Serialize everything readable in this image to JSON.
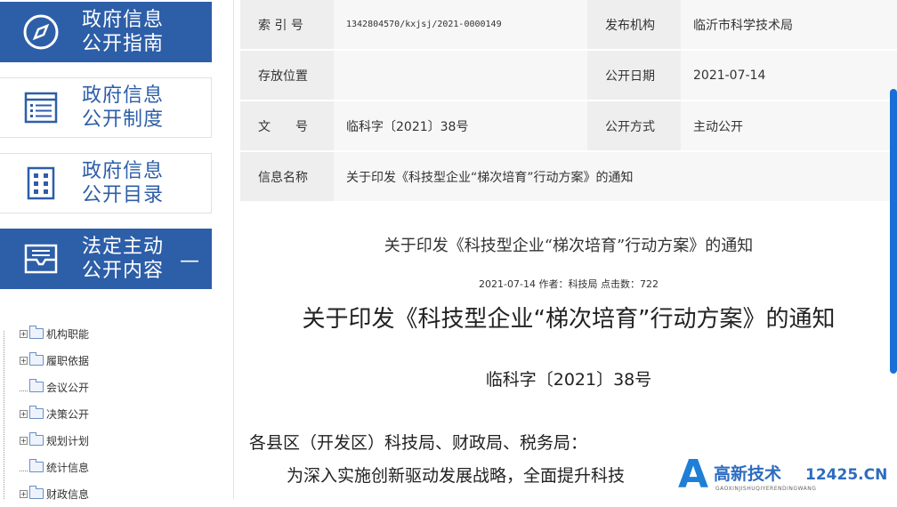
{
  "sidebar": {
    "cards": [
      {
        "line1": "政府信息",
        "line2": "公开指南",
        "icon": "compass-icon"
      },
      {
        "line1": "政府信息",
        "line2": "公开制度",
        "icon": "list-doc-icon"
      },
      {
        "line1": "政府信息",
        "line2": "公开目录",
        "icon": "grid-icon"
      },
      {
        "line1": "法定主动",
        "line2": "公开内容",
        "icon": "inbox-icon",
        "toggle": "—"
      }
    ],
    "tree": [
      {
        "label": "机构职能",
        "expand": "+"
      },
      {
        "label": "履职依据",
        "expand": "+"
      },
      {
        "label": "会议公开",
        "expand": ""
      },
      {
        "label": "决策公开",
        "expand": "+"
      },
      {
        "label": "规划计划",
        "expand": "+"
      },
      {
        "label": "统计信息",
        "expand": ""
      },
      {
        "label": "财政信息",
        "expand": "+"
      }
    ]
  },
  "meta": {
    "index_label": "索 引 号",
    "index_value": "1342804570/kxjsj/2021-0000149",
    "publisher_label": "发布机构",
    "publisher_value": "临沂市科学技术局",
    "location_label": "存放位置",
    "location_value": "",
    "date_label": "公开日期",
    "date_value": "2021-07-14",
    "docno_label": "文　　号",
    "docno_value": "临科字〔2021〕38号",
    "method_label": "公开方式",
    "method_value": "主动公开",
    "name_label": "信息名称",
    "name_value": "关于印发《科技型企业“梯次培育”行动方案》的通知"
  },
  "article": {
    "title_small": "关于印发《科技型企业“梯次培育”行动方案》的通知",
    "info": "2021-07-14   作者：科技局  点击数：722",
    "title_big": "关于印发《科技型企业“梯次培育”行动方案》的通知",
    "docno": "临科字〔2021〕38号",
    "salutation": "各县区（开发区）科技局、财政局、税务局：",
    "para1": "为深入实施创新驱动发展战略，全面提升科技"
  },
  "watermark": {
    "letter": "A",
    "text": "高新技术",
    "site_main": "12425",
    "site_suffix": ".CN",
    "sub": "GAOXINJISHUQIYERENDINGWANG"
  },
  "colors": {
    "brand_blue": "#2d5ea8",
    "scrollbar": "#1a6fd6",
    "watermark_orange": "#f08a1c"
  }
}
